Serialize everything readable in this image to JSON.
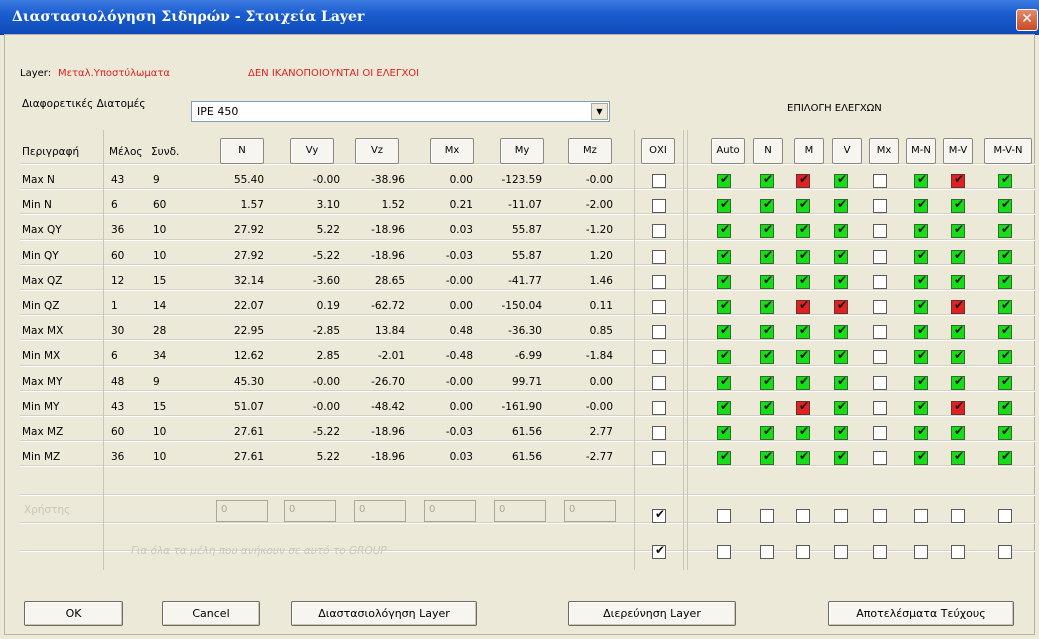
{
  "window": {
    "title": "Διαστασιολόγηση Σιδηρών - Στοιχεία Layer",
    "close_label": "✕"
  },
  "info": {
    "layer_label": "Layer:",
    "layer_name": "Μεταλ.Υποστύλωματα",
    "warning": "ΔΕΝ ΙΚΑΝΟΠΟΙΟΥΝΤΑΙ ΟΙ ΕΛΕΓΧΟΙ",
    "sections_label": "Διαφορετικές Διατομές",
    "section_value": "IPE 450",
    "checks_title": "ΕΠΙΛΟΓΗ ΕΛΕΓΧΩΝ"
  },
  "columns": {
    "description": "Περιγραφή",
    "member": "Μέλος",
    "combination": "Συνδ.",
    "forces": [
      "N",
      "Vy",
      "Vz",
      "Mx",
      "My",
      "Mz"
    ],
    "none": "ΟΧΙ",
    "checks": [
      "Auto",
      "N",
      "M",
      "V",
      "Mx",
      "M-N",
      "M-V",
      "M-V-N"
    ]
  },
  "rows": [
    {
      "desc": "Max N",
      "member": "43",
      "combo": "9",
      "vals": [
        "55.40",
        "-0.00",
        "-38.96",
        "0.00",
        "-123.59",
        "-0.00"
      ],
      "checks": [
        "g",
        "g",
        "r",
        "g",
        "w",
        "g",
        "r",
        "g"
      ]
    },
    {
      "desc": "Min N",
      "member": "6",
      "combo": "60",
      "vals": [
        "1.57",
        "3.10",
        "1.52",
        "0.21",
        "-11.07",
        "-2.00"
      ],
      "checks": [
        "g",
        "g",
        "g",
        "g",
        "w",
        "g",
        "g",
        "g"
      ]
    },
    {
      "desc": "Max QY",
      "member": "36",
      "combo": "10",
      "vals": [
        "27.92",
        "5.22",
        "-18.96",
        "0.03",
        "55.87",
        "-1.20"
      ],
      "checks": [
        "g",
        "g",
        "g",
        "g",
        "w",
        "g",
        "g",
        "g"
      ]
    },
    {
      "desc": "Min QY",
      "member": "60",
      "combo": "10",
      "vals": [
        "27.92",
        "-5.22",
        "-18.96",
        "-0.03",
        "55.87",
        "1.20"
      ],
      "checks": [
        "g",
        "g",
        "g",
        "g",
        "w",
        "g",
        "g",
        "g"
      ]
    },
    {
      "desc": "Max QZ",
      "member": "12",
      "combo": "15",
      "vals": [
        "32.14",
        "-3.60",
        "28.65",
        "-0.00",
        "-41.77",
        "1.46"
      ],
      "checks": [
        "g",
        "g",
        "g",
        "g",
        "w",
        "g",
        "g",
        "g"
      ]
    },
    {
      "desc": "Min QZ",
      "member": "1",
      "combo": "14",
      "vals": [
        "22.07",
        "0.19",
        "-62.72",
        "0.00",
        "-150.04",
        "0.11"
      ],
      "checks": [
        "g",
        "g",
        "r",
        "r",
        "w",
        "g",
        "r",
        "g"
      ]
    },
    {
      "desc": "Max MX",
      "member": "30",
      "combo": "28",
      "vals": [
        "22.95",
        "-2.85",
        "13.84",
        "0.48",
        "-36.30",
        "0.85"
      ],
      "checks": [
        "g",
        "g",
        "g",
        "g",
        "w",
        "g",
        "g",
        "g"
      ]
    },
    {
      "desc": "Min MX",
      "member": "6",
      "combo": "34",
      "vals": [
        "12.62",
        "2.85",
        "-2.01",
        "-0.48",
        "-6.99",
        "-1.84"
      ],
      "checks": [
        "g",
        "g",
        "g",
        "g",
        "w",
        "g",
        "g",
        "g"
      ]
    },
    {
      "desc": "Max MY",
      "member": "48",
      "combo": "9",
      "vals": [
        "45.30",
        "-0.00",
        "-26.70",
        "-0.00",
        "99.71",
        "0.00"
      ],
      "checks": [
        "g",
        "g",
        "g",
        "g",
        "w",
        "g",
        "g",
        "g"
      ]
    },
    {
      "desc": "Min MY",
      "member": "43",
      "combo": "15",
      "vals": [
        "51.07",
        "-0.00",
        "-48.42",
        "0.00",
        "-161.90",
        "-0.00"
      ],
      "checks": [
        "g",
        "g",
        "r",
        "g",
        "w",
        "g",
        "r",
        "g"
      ]
    },
    {
      "desc": "Max MZ",
      "member": "60",
      "combo": "10",
      "vals": [
        "27.61",
        "-5.22",
        "-18.96",
        "-0.03",
        "61.56",
        "2.77"
      ],
      "checks": [
        "g",
        "g",
        "g",
        "g",
        "w",
        "g",
        "g",
        "g"
      ]
    },
    {
      "desc": "Min MZ",
      "member": "36",
      "combo": "10",
      "vals": [
        "27.61",
        "5.22",
        "-18.96",
        "0.03",
        "61.56",
        "-2.77"
      ],
      "checks": [
        "g",
        "g",
        "g",
        "g",
        "w",
        "g",
        "g",
        "g"
      ]
    }
  ],
  "user_row": {
    "label": "Χρήστης",
    "inputs": [
      "0",
      "0",
      "0",
      "0",
      "0",
      "0"
    ]
  },
  "group_row": {
    "text": "Για όλα τα μέλη που ανήκουν σε αυτό το GROUP"
  },
  "buttons": {
    "ok": "OK",
    "cancel": "Cancel",
    "design": "Διαστασιολόγηση Layer",
    "investigate": "Διερεύνηση Layer",
    "results": "Αποτελέσματα Τεύχους"
  },
  "colors": {
    "titlebar": "#1b5ed0",
    "pass": "#16dd16",
    "fail": "#e12121",
    "warning_text": "#e02020"
  }
}
